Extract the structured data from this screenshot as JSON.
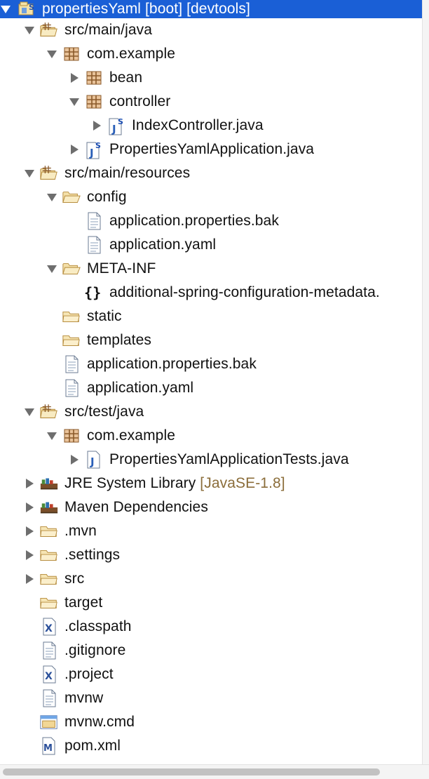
{
  "tree": [
    {
      "label": "propertiesYaml [boot] [devtools]",
      "level": 0,
      "twisty": "expanded",
      "icon": "project-icon",
      "selected": true
    },
    {
      "label": "src/main/java",
      "level": 1,
      "twisty": "expanded",
      "icon": "source-folder-icon"
    },
    {
      "label": "com.example",
      "level": 2,
      "twisty": "expanded",
      "icon": "package-icon"
    },
    {
      "label": "bean",
      "level": 3,
      "twisty": "collapsed",
      "icon": "package-icon"
    },
    {
      "label": "controller",
      "level": 3,
      "twisty": "expanded",
      "icon": "package-icon"
    },
    {
      "label": "IndexController.java",
      "level": 4,
      "twisty": "collapsed",
      "icon": "java-spring-file-icon"
    },
    {
      "label": "PropertiesYamlApplication.java",
      "level": 3,
      "twisty": "collapsed",
      "icon": "java-spring-file-icon"
    },
    {
      "label": "src/main/resources",
      "level": 1,
      "twisty": "expanded",
      "icon": "source-folder-icon"
    },
    {
      "label": "config",
      "level": 2,
      "twisty": "expanded",
      "icon": "folder-open-icon"
    },
    {
      "label": "application.properties.bak",
      "level": 3,
      "twisty": "none",
      "icon": "text-file-icon"
    },
    {
      "label": "application.yaml",
      "level": 3,
      "twisty": "none",
      "icon": "text-file-icon"
    },
    {
      "label": "META-INF",
      "level": 2,
      "twisty": "expanded",
      "icon": "folder-open-icon"
    },
    {
      "label": "additional-spring-configuration-metadata.",
      "level": 3,
      "twisty": "none",
      "icon": "json-file-icon"
    },
    {
      "label": "static",
      "level": 2,
      "twisty": "none",
      "icon": "folder-icon"
    },
    {
      "label": "templates",
      "level": 2,
      "twisty": "none",
      "icon": "folder-icon"
    },
    {
      "label": "application.properties.bak",
      "level": 2,
      "twisty": "none",
      "icon": "text-file-icon"
    },
    {
      "label": "application.yaml",
      "level": 2,
      "twisty": "none",
      "icon": "text-file-icon"
    },
    {
      "label": "src/test/java",
      "level": 1,
      "twisty": "expanded",
      "icon": "source-folder-icon"
    },
    {
      "label": "com.example",
      "level": 2,
      "twisty": "expanded",
      "icon": "package-icon"
    },
    {
      "label": "PropertiesYamlApplicationTests.java",
      "level": 3,
      "twisty": "collapsed",
      "icon": "java-file-icon"
    },
    {
      "label": "JRE System Library",
      "decoration": "[JavaSE-1.8]",
      "level": 1,
      "twisty": "collapsed",
      "icon": "library-icon"
    },
    {
      "label": "Maven Dependencies",
      "level": 1,
      "twisty": "collapsed",
      "icon": "library-icon"
    },
    {
      "label": ".mvn",
      "level": 1,
      "twisty": "collapsed",
      "icon": "folder-icon"
    },
    {
      "label": ".settings",
      "level": 1,
      "twisty": "collapsed",
      "icon": "folder-icon"
    },
    {
      "label": "src",
      "level": 1,
      "twisty": "collapsed",
      "icon": "folder-icon"
    },
    {
      "label": "target",
      "level": 1,
      "twisty": "none",
      "icon": "folder-icon"
    },
    {
      "label": ".classpath",
      "level": 1,
      "twisty": "none",
      "icon": "xml-file-icon"
    },
    {
      "label": ".gitignore",
      "level": 1,
      "twisty": "none",
      "icon": "text-file-icon"
    },
    {
      "label": ".project",
      "level": 1,
      "twisty": "none",
      "icon": "xml-file-icon"
    },
    {
      "label": "mvnw",
      "level": 1,
      "twisty": "none",
      "icon": "text-file-icon"
    },
    {
      "label": "mvnw.cmd",
      "level": 1,
      "twisty": "none",
      "icon": "cmd-file-icon"
    },
    {
      "label": "pom.xml",
      "level": 1,
      "twisty": "none",
      "icon": "maven-pom-icon"
    }
  ]
}
